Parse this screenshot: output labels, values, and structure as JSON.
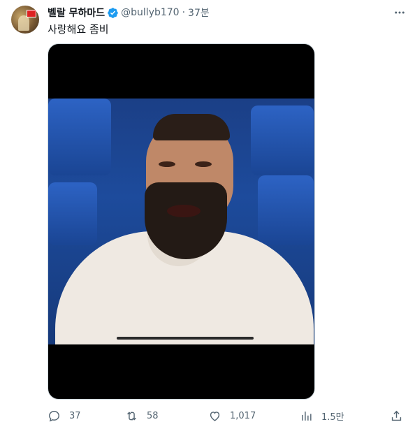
{
  "tweet": {
    "author_name": "벨랄 무하마드",
    "handle": "@bullyb170",
    "separator": "·",
    "time": "37분",
    "text": "사랑해요 좀비"
  },
  "actions": {
    "replies": "37",
    "retweets": "58",
    "likes": "1,017",
    "views": "1.5만"
  },
  "colors": {
    "verified": "#1d9bf0",
    "muted": "#536471",
    "text": "#0f1419"
  },
  "icons": [
    "verified-badge-icon",
    "more-icon",
    "reply-icon",
    "retweet-icon",
    "like-icon",
    "views-icon",
    "share-icon"
  ]
}
